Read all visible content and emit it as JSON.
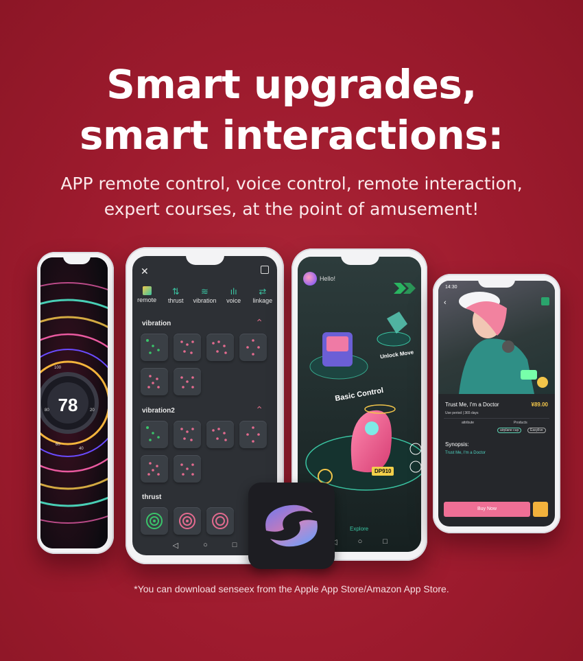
{
  "headline": [
    "Smart upgrades,",
    "smart interactions:"
  ],
  "subline": [
    "APP remote control, voice control, remote interaction,",
    "expert courses, at the point of amusement!"
  ],
  "footnote": "*You can download senseex from the Apple App Store/Amazon App Store.",
  "phone1": {
    "gauge_value": "78",
    "ticks": [
      "100",
      "80",
      "60",
      "40",
      "20"
    ]
  },
  "phone2": {
    "tabs": [
      {
        "label": "remote",
        "icon": "remote-icon"
      },
      {
        "label": "thrust",
        "icon": "thrust-icon"
      },
      {
        "label": "vibration",
        "icon": "vibration-icon"
      },
      {
        "label": "voice",
        "icon": "voice-icon"
      },
      {
        "label": "linkage",
        "icon": "linkage-icon"
      }
    ],
    "sections": [
      "vibration",
      "vibration2",
      "thrust"
    ]
  },
  "phone3": {
    "greeting": "Hello!",
    "basic_label": "Basic Control",
    "unlock_label": "Unlock Move",
    "code": "DP910",
    "bottom_label": "Explore"
  },
  "phone4": {
    "time": "14:30",
    "title": "Trust Me, I'm a Doctor",
    "price": "¥89.00",
    "period": "Use period | 365 days",
    "attribute_label": "attribute",
    "products_label": "Products",
    "products": [
      "airplane cup",
      "Easylive"
    ],
    "synopsis_label": "Synopsis:",
    "synopsis": "Trust Me, I'm a Doctor",
    "buy_label": "Buy Now"
  },
  "colors": {
    "background": "#a31e31",
    "accent_teal": "#3ac4a2",
    "accent_pink": "#ef6f95"
  }
}
